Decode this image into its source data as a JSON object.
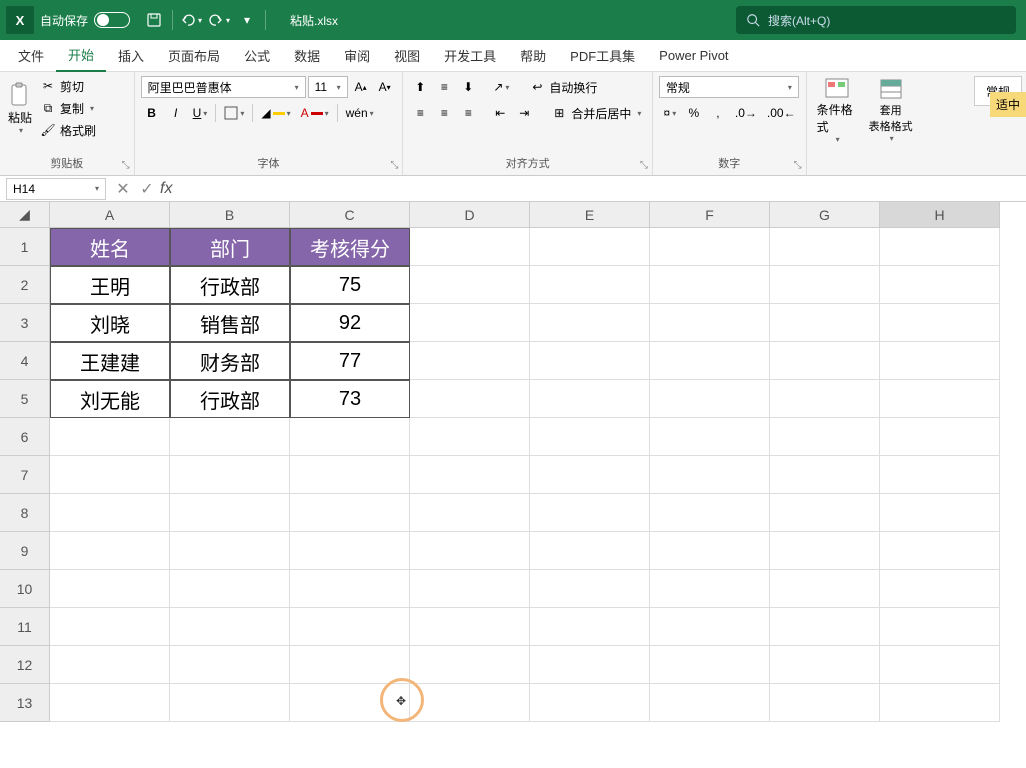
{
  "titlebar": {
    "app_abbrev": "X",
    "autosave_label": "自动保存",
    "filename": "粘贴.xlsx",
    "search_placeholder": "搜索(Alt+Q)"
  },
  "tabs": {
    "items": [
      "文件",
      "开始",
      "插入",
      "页面布局",
      "公式",
      "数据",
      "审阅",
      "视图",
      "开发工具",
      "帮助",
      "PDF工具集",
      "Power Pivot"
    ],
    "active_index": 1
  },
  "ribbon": {
    "clipboard": {
      "paste": "粘贴",
      "cut": "剪切",
      "copy": "复制",
      "format_painter": "格式刷",
      "group_label": "剪贴板"
    },
    "font": {
      "font_name": "阿里巴巴普惠体",
      "font_size": "11",
      "group_label": "字体",
      "wen": "wén"
    },
    "alignment": {
      "wrap": "自动换行",
      "merge": "合并后居中",
      "group_label": "对齐方式"
    },
    "number": {
      "format": "常规",
      "group_label": "数字"
    },
    "styles": {
      "cond_format": "条件格式",
      "table_format": "套用\n表格格式",
      "general": "常规",
      "adapt": "适中"
    }
  },
  "formula_bar": {
    "name_box": "H14",
    "fx_value": ""
  },
  "columns": [
    "A",
    "B",
    "C",
    "D",
    "E",
    "F",
    "G",
    "H"
  ],
  "rows": [
    "1",
    "2",
    "3",
    "4",
    "5",
    "6",
    "7",
    "8",
    "9",
    "10",
    "11",
    "12",
    "13"
  ],
  "table": {
    "headers": [
      "姓名",
      "部门",
      "考核得分"
    ],
    "data": [
      {
        "name": "王明",
        "dept": "行政部",
        "score": "75"
      },
      {
        "name": "刘晓",
        "dept": "销售部",
        "score": "92"
      },
      {
        "name": "王建建",
        "dept": "财务部",
        "score": "77"
      },
      {
        "name": "刘无能",
        "dept": "行政部",
        "score": "73"
      }
    ]
  }
}
